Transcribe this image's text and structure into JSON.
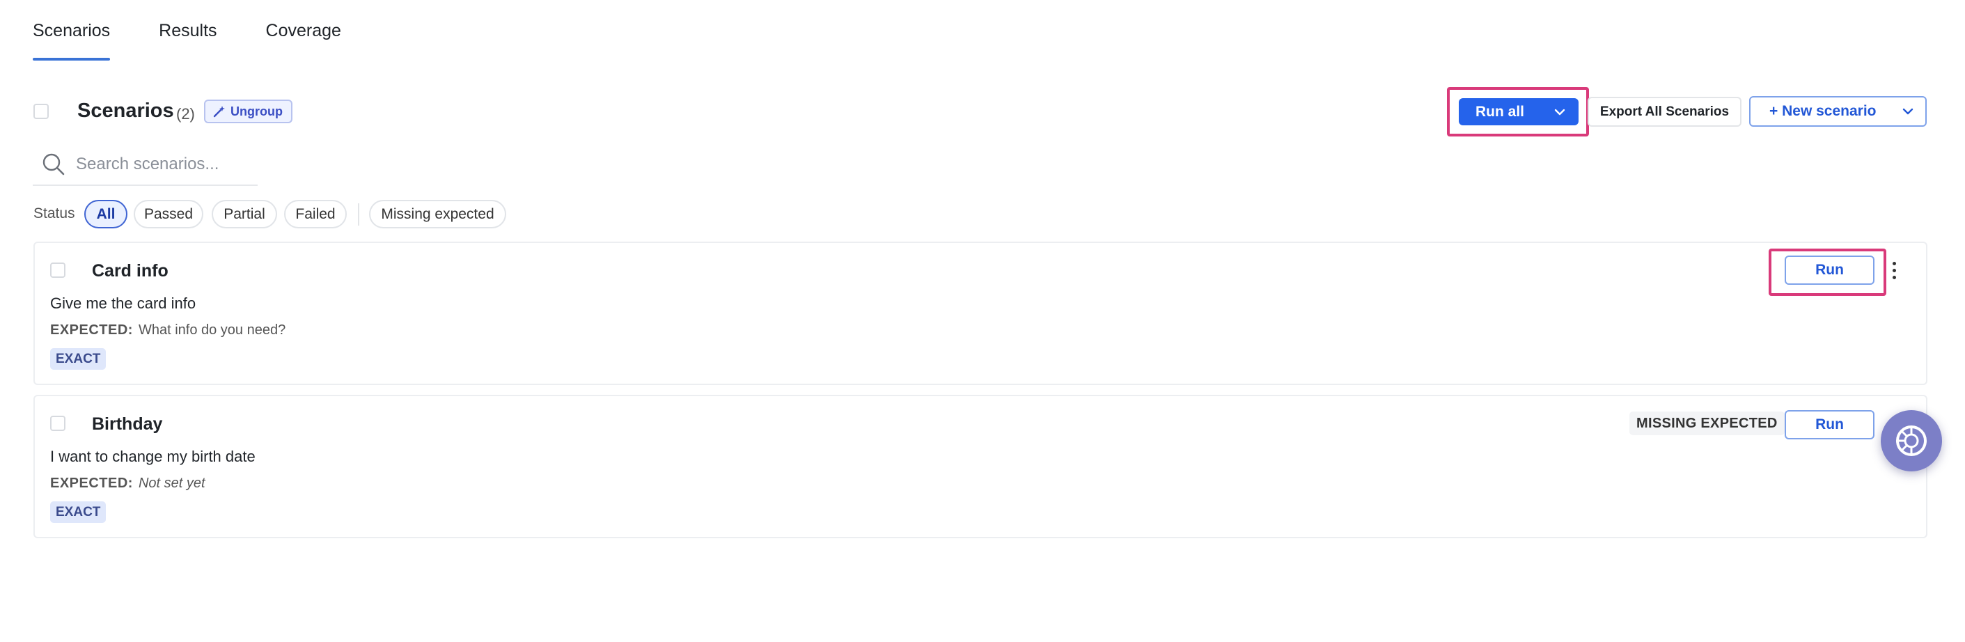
{
  "tabs": [
    {
      "label": "Scenarios",
      "active": true
    },
    {
      "label": "Results",
      "active": false
    },
    {
      "label": "Coverage",
      "active": false
    }
  ],
  "header": {
    "title": "Scenarios",
    "count": "(2)",
    "ungroup_label": "Ungroup"
  },
  "toolbar": {
    "run_all_label": "Run all",
    "export_label": "Export All Scenarios",
    "new_scenario_label": "+ New scenario"
  },
  "search": {
    "placeholder": "Search scenarios..."
  },
  "status_filter": {
    "label": "Status",
    "options": [
      "All",
      "Passed",
      "Partial",
      "Failed",
      "Missing expected"
    ],
    "selected": "All"
  },
  "scenarios": [
    {
      "title": "Card info",
      "prompt": "Give me the card info",
      "expected_label": "EXPECTED:",
      "expected_value": "What info do you need?",
      "match_type": "EXACT",
      "status_badge": "",
      "run_label": "Run"
    },
    {
      "title": "Birthday",
      "prompt": "I want to change my birth date",
      "expected_label": "EXPECTED:",
      "expected_value": "Not set yet",
      "match_type": "EXACT",
      "status_badge": "MISSING EXPECTED",
      "run_label": "Run"
    }
  ],
  "colors": {
    "accent": "#2563eb",
    "highlight": "#d93a7a",
    "fab": "#7c7fc7"
  }
}
